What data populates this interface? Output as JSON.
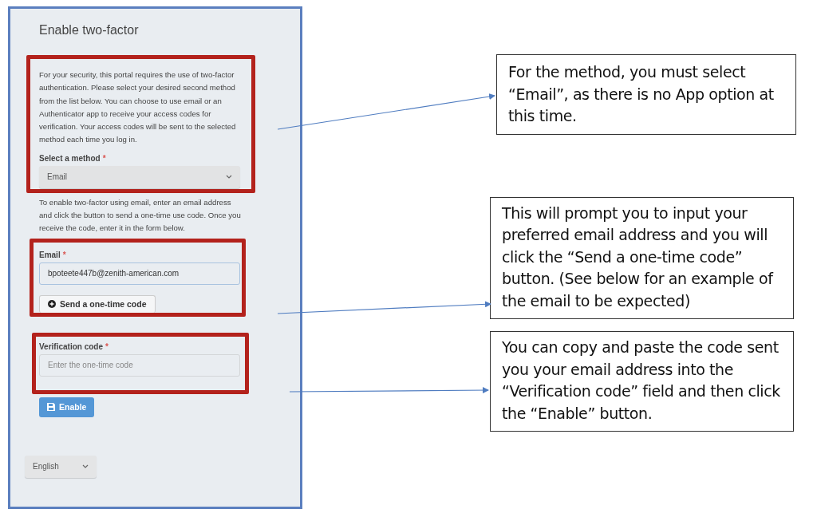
{
  "form": {
    "title": "Enable two-factor",
    "intro": "For your security, this portal requires the use of two-factor authentication. Please select your desired second method from the list below. You can choose to use email or an Authenticator app to receive your access codes for verification. Your access codes will be sent to the selected method each time you log in.",
    "method": {
      "label": "Select a method",
      "mark": "*",
      "value": "Email"
    },
    "instructions": "To enable two-factor using email, enter an email address and click the button to send a one-time use code. Once you receive the code, enter it in the form below.",
    "email": {
      "label": "Email",
      "mark": "*",
      "value": "bpoteete447b@zenith-american.com"
    },
    "send_button": "Send a one-time code",
    "verification": {
      "label": "Verification code",
      "mark": "*",
      "placeholder": "Enter the one-time code"
    },
    "enable_button": "Enable",
    "language": "English"
  },
  "callouts": [
    {
      "text": "For the method, you must select “Email”, as there is no App option at this time."
    },
    {
      "text": "This will prompt you to input your preferred email address and you will click the “Send a one-time code” button. (See below for an example of the email to be expected)"
    },
    {
      "text": "You can copy and paste the code sent you your email address into the “Verification code” field and then click the “Enable” button."
    }
  ]
}
